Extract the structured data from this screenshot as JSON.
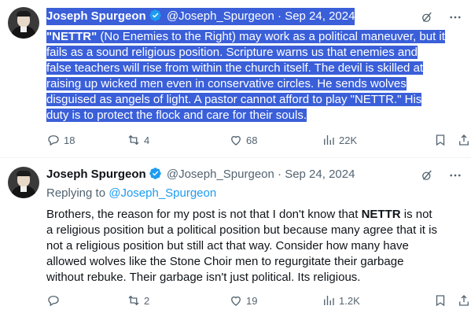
{
  "tweets": [
    {
      "author_name": "Joseph Spurgeon",
      "handle": "@Joseph_Spurgeon",
      "separator": "·",
      "date": "Sep 24, 2024",
      "body_lines": [
        {
          "bold": "\"NETTR\"",
          "text": " (No Enemies to the Right) may work as a political maneuver, but it"
        },
        {
          "bold": "",
          "text": "fails as a sound religious position. Scripture warns us that enemies and"
        },
        {
          "bold": "",
          "text": "false teachers will rise from within the church itself. The devil is skilled at"
        },
        {
          "bold": "",
          "text": "raising up wicked men even in conservative circles. He sends wolves"
        },
        {
          "bold": "",
          "text": "disguised as angels of light. A pastor cannot afford to play \"NETTR.\" His"
        },
        {
          "bold": "",
          "text": "duty is to protect the flock and care for their souls."
        }
      ],
      "replies": "18",
      "reposts": "4",
      "likes": "68",
      "views": "22K"
    },
    {
      "author_name": "Joseph Spurgeon",
      "handle": "@Joseph_Spurgeon",
      "separator": "·",
      "date": "Sep 24, 2024",
      "replying_to_label": "Replying to",
      "replying_to_handle": "@Joseph_Spurgeon",
      "body_line1_pre": "Brothers,  the reason for my post is not that I don't know that ",
      "body_line1_bold": "NETTR",
      "body_line1_post": " is not",
      "body_lines_rest": [
        "a religious position but a political position but because many agree that it is",
        "not a religious position but still act that way.  Consider how many have",
        "allowed wolves like the Stone Choir men to regurgitate their garbage",
        "without rebuke.  Their garbage isn't just political.  Its religious."
      ],
      "replies": "",
      "reposts": "2",
      "likes": "19",
      "views": "1.2K"
    }
  ],
  "icons": {
    "verified": "verified-badge-icon",
    "grok": "grok-icon",
    "more": "more-icon",
    "reply": "reply-icon",
    "repost": "repost-icon",
    "like": "like-icon",
    "views": "views-icon",
    "bookmark": "bookmark-icon",
    "share": "share-icon"
  },
  "colors": {
    "selection": "#3a5fd9",
    "link": "#1d9bf0",
    "muted": "#536471",
    "text": "#0f1419"
  }
}
